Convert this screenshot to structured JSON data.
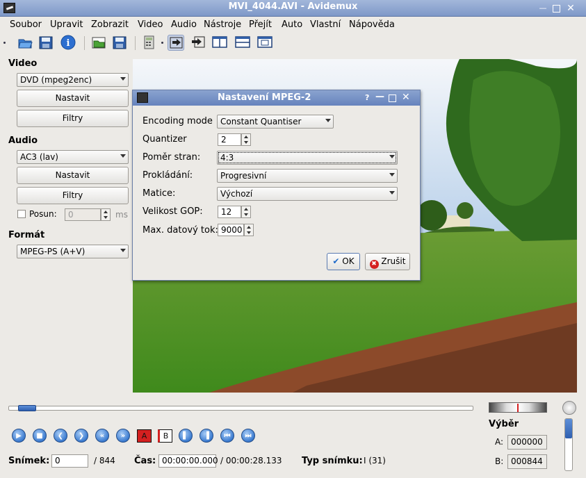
{
  "window": {
    "title": "MVI_4044.AVI - Avidemux"
  },
  "menu": {
    "items": [
      "Soubor",
      "Upravit",
      "Zobrazit",
      "Video",
      "Audio",
      "Nástroje",
      "Přejít",
      "Auto",
      "Vlastní",
      "Nápověda"
    ]
  },
  "sidebar": {
    "video_heading": "Video",
    "video_codec": "DVD (mpeg2enc)",
    "video_configure": "Nastavit",
    "video_filters": "Filtry",
    "audio_heading": "Audio",
    "audio_codec": "AC3 (lav)",
    "audio_configure": "Nastavit",
    "audio_filters": "Filtry",
    "shift_label": "Posun:",
    "shift_value": "0",
    "shift_unit": "ms",
    "format_heading": "Formát",
    "format_value": "MPEG-PS (A+V)"
  },
  "dialog": {
    "title": "Nastavení MPEG-2",
    "help": "?",
    "encoding_mode_label": "Encoding mode",
    "encoding_mode_value": "Constant Quantiser",
    "quantizer_label": "Quantizer",
    "quantizer_value": "2",
    "aspect_label": "Poměr stran:",
    "aspect_value": "4:3",
    "interlace_label": "Prokládání:",
    "interlace_value": "Progresivní",
    "matrix_label": "Matice:",
    "matrix_value": "Výchozí",
    "gop_label": "Velikost GOP:",
    "gop_value": "12",
    "bitrate_label": "Max. datový tok:",
    "bitrate_value": "9000",
    "ok_label": "OK",
    "cancel_label": "Zrušit"
  },
  "controls": {
    "marker_a": "A",
    "marker_b": "B",
    "seek_position": 0.02
  },
  "status": {
    "frame_label": "Snímek:",
    "frame_value": "0",
    "frame_total": "/ 844",
    "time_label": "Čas:",
    "time_value": "00:00:00.000",
    "time_total": "/ 00:00:28.133",
    "frame_type_label": "Typ snímku:",
    "frame_type_value": "I (31)"
  },
  "selection": {
    "heading": "Výběr",
    "a_label": "A:",
    "a_value": "000000",
    "b_label": "B:",
    "b_value": "000844"
  },
  "colors": {
    "accent": "#3b7bd0",
    "title_bar": "#7e98c8",
    "marker_red": "#d42020"
  }
}
